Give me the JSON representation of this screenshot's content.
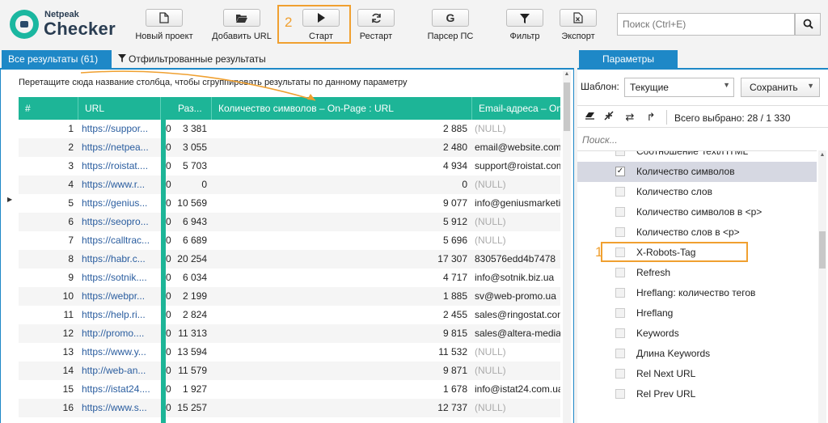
{
  "logo": {
    "small": "Netpeak",
    "big": "Checker"
  },
  "toolbar": {
    "new_project": "Новый проект",
    "add_url": "Добавить URL",
    "start": "Старт",
    "restart": "Рестарт",
    "serp_parser": "Парсер ПС",
    "filter": "Фильтр",
    "export": "Экспорт",
    "serp_icon_glyph": "G"
  },
  "search": {
    "placeholder": "Поиск (Ctrl+E)"
  },
  "annotations": {
    "one": "1",
    "two": "2"
  },
  "tabs": {
    "all_results": "Все результаты (61)",
    "filtered_results": "Отфильтрованные результаты",
    "parameters": "Параметры"
  },
  "grid": {
    "group_hint": "Перетащите сюда название столбца, чтобы сгруппировать результаты по данному параметру",
    "headers": {
      "num": "#",
      "url": "URL",
      "size": "Раз...",
      "char_count": "Количество символов – On-Page : URL",
      "email": "Email-адреса – On-Page"
    },
    "rows": [
      {
        "n": "1",
        "url": "https://suppor...",
        "left": "0",
        "size": "3 381",
        "chars": "2 885",
        "email": "(NULL)"
      },
      {
        "n": "2",
        "url": "https://netpea...",
        "left": "0",
        "size": "3 055",
        "chars": "2 480",
        "email": "email@website.com"
      },
      {
        "n": "3",
        "url": "https://roistat....",
        "left": "0",
        "size": "5 703",
        "chars": "4 934",
        "email": "support@roistat.com"
      },
      {
        "n": "4",
        "url": "https://www.r...",
        "left": "0",
        "size": "0",
        "chars": "0",
        "email": "(NULL)"
      },
      {
        "n": "5",
        "url": "https://genius...",
        "left": "0",
        "size": "10 569",
        "chars": "9 077",
        "email": "info@geniusmarketing.me"
      },
      {
        "n": "6",
        "url": "https://seopro...",
        "left": "0",
        "size": "6 943",
        "chars": "5 912",
        "email": "(NULL)"
      },
      {
        "n": "7",
        "url": "https://calltrac...",
        "left": "0",
        "size": "6 689",
        "chars": "5 696",
        "email": "(NULL)"
      },
      {
        "n": "8",
        "url": "https://habr.c...",
        "left": "0",
        "size": "20 254",
        "chars": "17 307",
        "email": "830576edd4b7478"
      },
      {
        "n": "9",
        "url": "https://sotnik....",
        "left": "0",
        "size": "6 034",
        "chars": "4 717",
        "email": "info@sotnik.biz.ua"
      },
      {
        "n": "10",
        "url": "https://webpr...",
        "left": "0",
        "size": "2 199",
        "chars": "1 885",
        "email": "sv@web-promo.ua"
      },
      {
        "n": "11",
        "url": "https://help.ri...",
        "left": "0",
        "size": "2 824",
        "chars": "2 455",
        "email": "sales@ringostat.com"
      },
      {
        "n": "12",
        "url": "http://promo....",
        "left": "0",
        "size": "11 313",
        "chars": "9 815",
        "email": "sales@altera-media.com"
      },
      {
        "n": "13",
        "url": "https://www.y...",
        "left": "0",
        "size": "13 594",
        "chars": "11 532",
        "email": "(NULL)"
      },
      {
        "n": "14",
        "url": "http://web-an...",
        "left": "0",
        "size": "11 579",
        "chars": "9 871",
        "email": "(NULL)"
      },
      {
        "n": "15",
        "url": "https://istat24....",
        "left": "0",
        "size": "1 927",
        "chars": "1 678",
        "email": "info@istat24.com.ua"
      },
      {
        "n": "16",
        "url": "https://www.s...",
        "left": "0",
        "size": "15 257",
        "chars": "12 737",
        "email": "(NULL)"
      }
    ]
  },
  "params": {
    "template_label": "Шаблон:",
    "template_value": "Текущие",
    "save_label": "Сохранить",
    "total_selected": "Всего выбрано: 28 / 1 330",
    "filter_placeholder": "Поиск...",
    "items": [
      {
        "label": "Соотношение Text/HTML",
        "checked": false
      },
      {
        "label": "Количество символов",
        "checked": true
      },
      {
        "label": "Количество слов",
        "checked": false
      },
      {
        "label": "Количество символов в <p>",
        "checked": false
      },
      {
        "label": "Количество слов в <p>",
        "checked": false
      },
      {
        "label": "X-Robots-Tag",
        "checked": false
      },
      {
        "label": "Refresh",
        "checked": false
      },
      {
        "label": "Hreflang: количество тегов",
        "checked": false
      },
      {
        "label": "Hreflang",
        "checked": false
      },
      {
        "label": "Keywords",
        "checked": false
      },
      {
        "label": "Длина Keywords",
        "checked": false
      },
      {
        "label": "Rel Next URL",
        "checked": false
      },
      {
        "label": "Rel Prev URL",
        "checked": false
      }
    ]
  },
  "colors": {
    "accent_blue": "#1e88c7",
    "grid_header": "#1db597",
    "highlight_orange": "#f0a030",
    "link": "#2a5d9f"
  }
}
